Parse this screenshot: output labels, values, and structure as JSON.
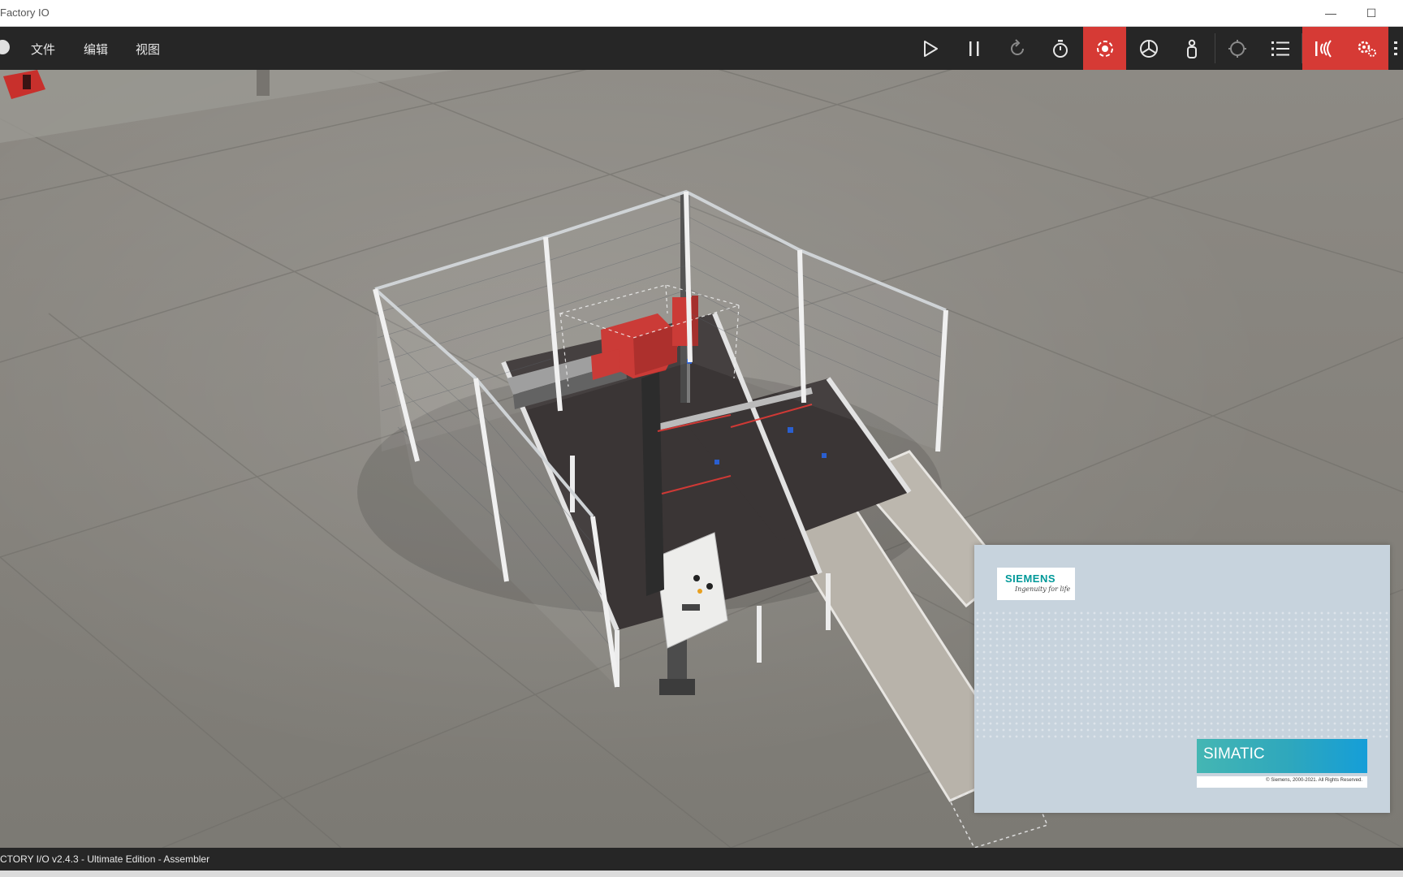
{
  "window": {
    "title": "Factory IO",
    "minimize_glyph": "—",
    "maximize_glyph": "☐"
  },
  "menu": {
    "home_icon": "home-icon",
    "items": [
      {
        "label": "文件"
      },
      {
        "label": "编辑"
      },
      {
        "label": "视图"
      }
    ]
  },
  "toolbar": {
    "buttons": [
      {
        "name": "play-icon",
        "active": false
      },
      {
        "name": "pause-icon",
        "active": false
      },
      {
        "name": "reset-icon",
        "active": false
      },
      {
        "name": "timer-icon",
        "active": false
      },
      {
        "name": "camera-orbit-icon",
        "active": true
      },
      {
        "name": "fly-camera-icon",
        "active": false
      },
      {
        "name": "first-person-icon",
        "active": false
      },
      {
        "name": "selection-icon",
        "active": false
      },
      {
        "name": "palette-list-icon",
        "active": false
      },
      {
        "name": "sensors-icon",
        "active": true
      },
      {
        "name": "drivers-icon",
        "active": true
      }
    ],
    "accent_color": "#d63a35"
  },
  "splash": {
    "brand": "SIEMENS",
    "tagline": "Ingenuity for life",
    "product": "SIMATIC",
    "copyright": "© Siemens, 2000-2021. All Rights Reserved."
  },
  "status": {
    "text": "CTORY I/O v2.4.3 - Ultimate Edition - Assembler"
  }
}
